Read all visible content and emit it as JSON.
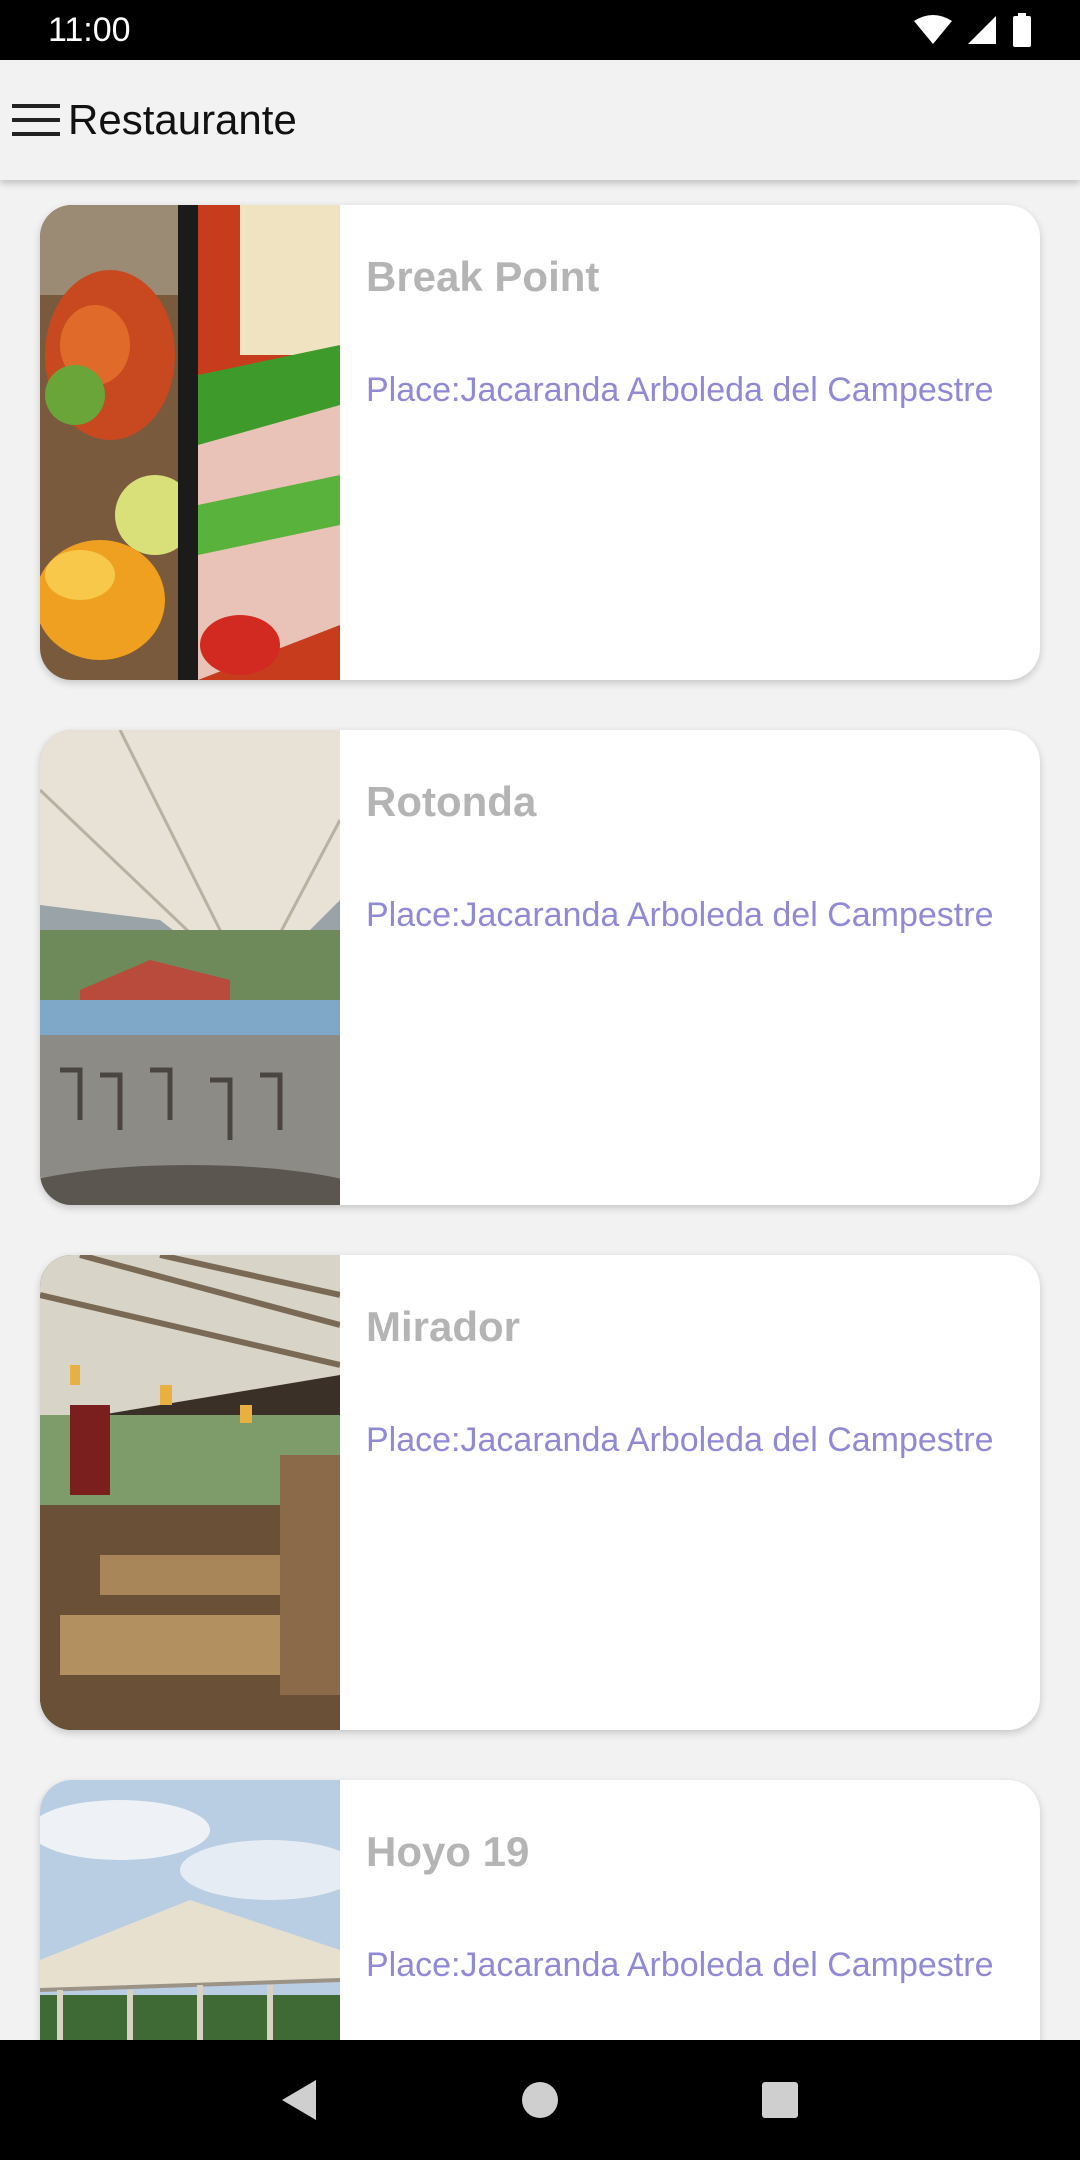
{
  "status_bar": {
    "time": "11:00"
  },
  "app_bar": {
    "title": "Restaurante",
    "menu_icon": "hamburger-menu-icon"
  },
  "restaurants": [
    {
      "name": "Break Point",
      "place": "Place:Jacaranda Arboleda del Campestre",
      "image": "food-photo"
    },
    {
      "name": "Rotonda",
      "place": "Place:Jacaranda Arboleda del Campestre",
      "image": "tent-terrace-photo"
    },
    {
      "name": "Mirador",
      "place": "Place:Jacaranda Arboleda del Campestre",
      "image": "dining-hall-photo"
    },
    {
      "name": "Hoyo 19",
      "place": "Place:Jacaranda Arboleda del Campestre",
      "image": "outdoor-canopy-photo"
    }
  ],
  "nav_bar": {
    "back_icon": "back-triangle-icon",
    "home_icon": "home-circle-icon",
    "recents_icon": "recents-square-icon"
  },
  "colors": {
    "title": "#b4b4b4",
    "place": "#8f89d6",
    "background": "#f2f2f2"
  }
}
